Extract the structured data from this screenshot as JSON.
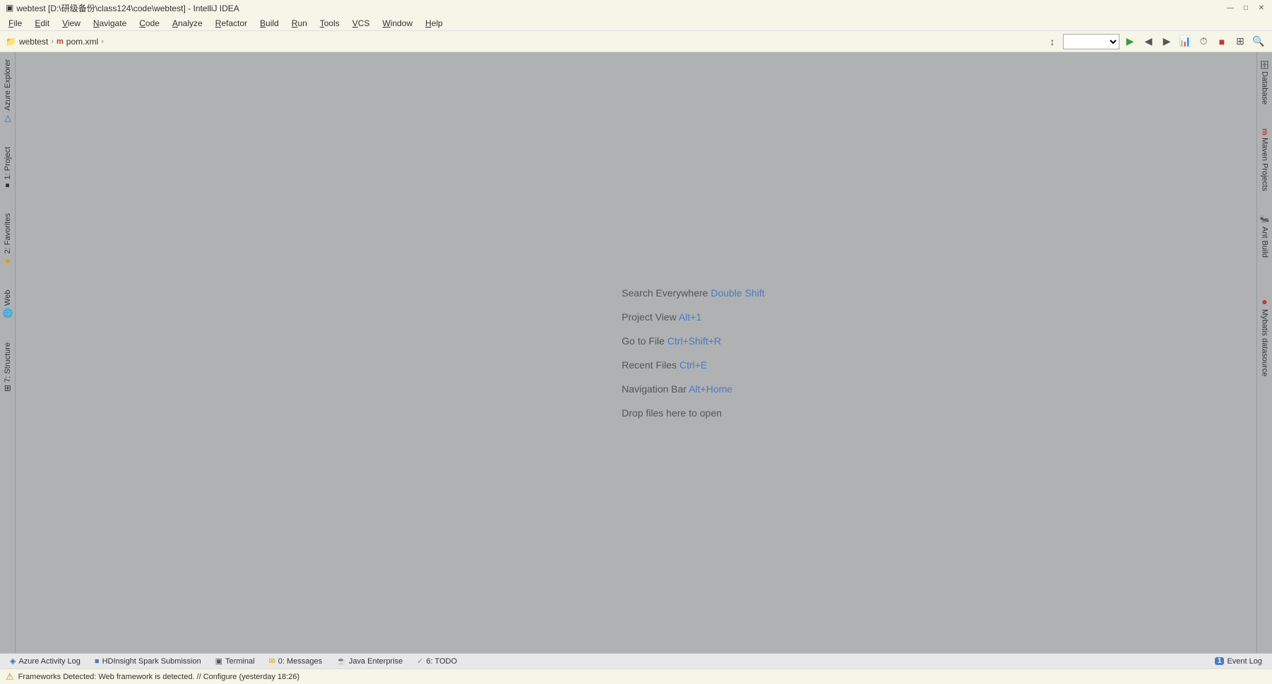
{
  "titlebar": {
    "icon": "▣",
    "title": "webtest [D:\\研级备份\\class124\\code\\webtest] - IntelliJ IDEA",
    "minimize": "—",
    "maximize": "□",
    "close": "✕"
  },
  "menu": {
    "items": [
      "File",
      "Edit",
      "View",
      "Navigate",
      "Code",
      "Analyze",
      "Refactor",
      "Build",
      "Run",
      "Tools",
      "VCS",
      "Window",
      "Help"
    ]
  },
  "toolbar": {
    "breadcrumb": [
      {
        "text": "webtest",
        "icon": "📁"
      },
      {
        "text": "pom.xml",
        "icon": "m"
      }
    ],
    "sep": "›"
  },
  "left_sidebar": {
    "tabs": [
      {
        "label": "Azure Explorer",
        "icon": "△"
      },
      {
        "label": "1: Project",
        "icon": "■"
      },
      {
        "label": "2: Favorites",
        "icon": "★"
      },
      {
        "label": "Web",
        "icon": "🌐"
      },
      {
        "label": "7: Structure",
        "icon": "⊞"
      }
    ]
  },
  "right_sidebar": {
    "tabs": [
      {
        "label": "Database",
        "icon": "🗄"
      },
      {
        "label": "Maven Projects",
        "icon": "m"
      },
      {
        "label": "Ant Build",
        "icon": "🐜"
      },
      {
        "label": "Mybatis datasource",
        "icon": "●"
      }
    ]
  },
  "editor": {
    "hints": [
      {
        "text": "Search Everywhere",
        "shortcut": "Double Shift"
      },
      {
        "text": "Project View",
        "shortcut": "Alt+1"
      },
      {
        "text": "Go to File",
        "shortcut": "Ctrl+Shift+R"
      },
      {
        "text": "Recent Files",
        "shortcut": "Ctrl+E"
      },
      {
        "text": "Navigation Bar",
        "shortcut": "Alt+Home"
      },
      {
        "text": "Drop files here to open",
        "shortcut": ""
      }
    ]
  },
  "bottom_bar": {
    "tabs": [
      {
        "icon": "◈",
        "label": "Azure Activity Log",
        "color": "#2672b8"
      },
      {
        "icon": "■",
        "label": "HDInsight Spark Submission",
        "color": "#4a7cc4"
      },
      {
        "icon": "▣",
        "label": "Terminal",
        "color": "#555"
      },
      {
        "icon": "✉",
        "label": "0: Messages",
        "color": "#d4a017"
      },
      {
        "icon": "☕",
        "label": "Java Enterprise",
        "color": "#cc8800"
      },
      {
        "icon": "✓",
        "label": "6: TODO",
        "color": "#888"
      }
    ],
    "event_log": {
      "badge": "1",
      "label": "Event Log"
    }
  },
  "status_bar": {
    "warning_icon": "⚠",
    "text": "Frameworks Detected: Web framework is detected. // Configure (yesterday 18:26)"
  }
}
